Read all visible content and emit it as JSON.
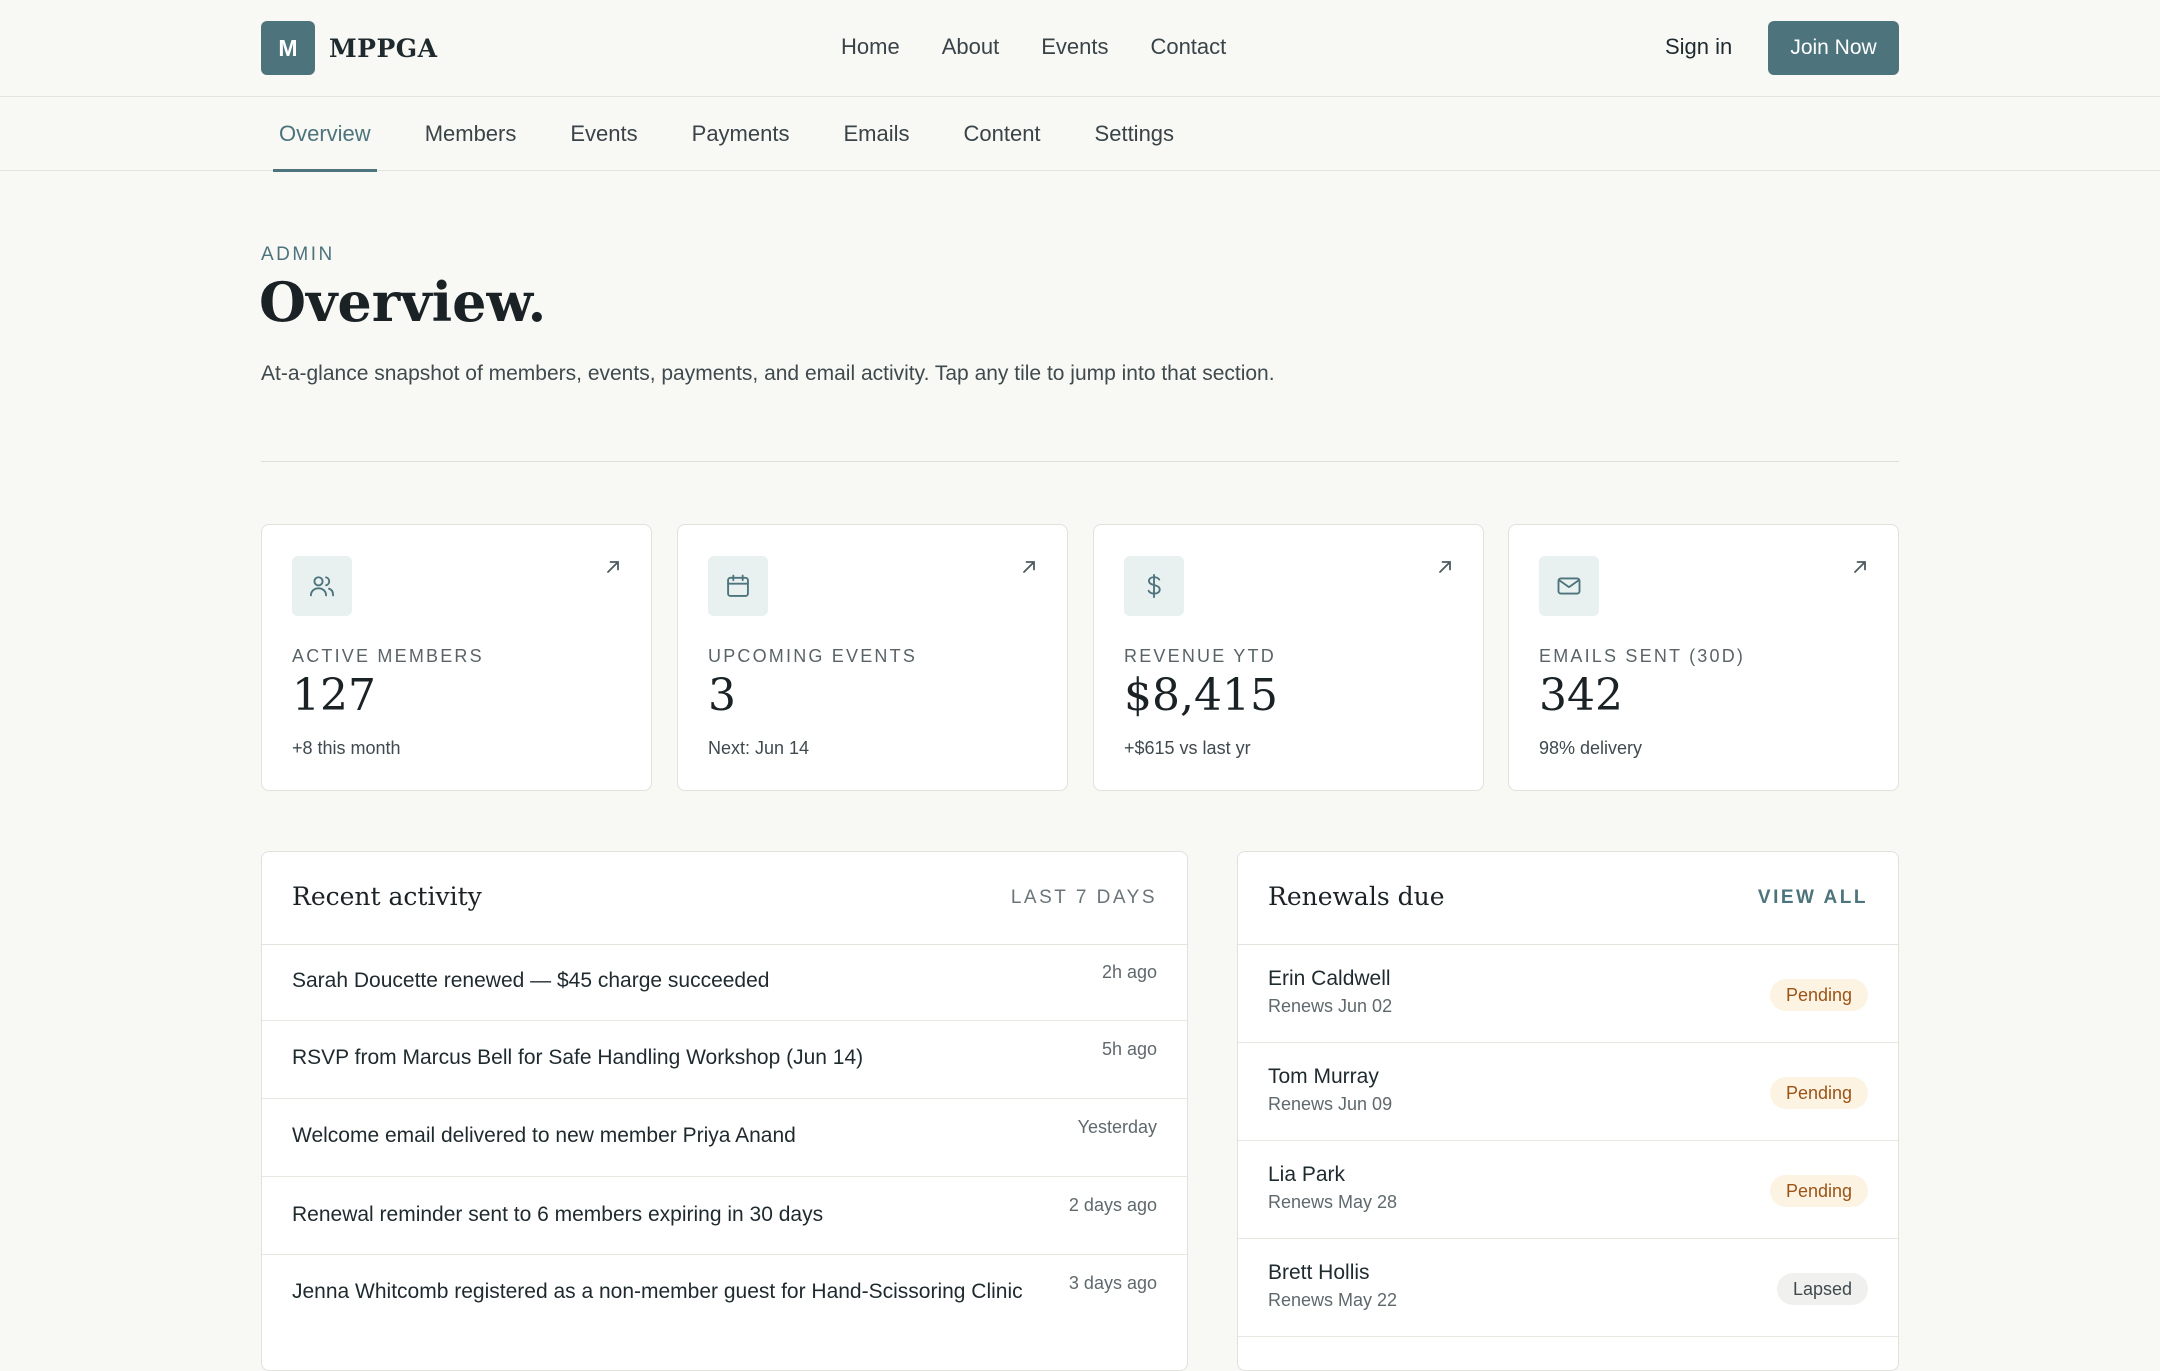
{
  "brand": {
    "mark": "M",
    "name": "MPPGA"
  },
  "main_nav": [
    "Home",
    "About",
    "Events",
    "Contact"
  ],
  "auth": {
    "sign_in": "Sign in",
    "join": "Join Now"
  },
  "admin_tabs": [
    "Overview",
    "Members",
    "Events",
    "Payments",
    "Emails",
    "Content",
    "Settings"
  ],
  "active_tab": "Overview",
  "header": {
    "eyebrow": "ADMIN",
    "title": "Overview.",
    "description": "At-a-glance snapshot of members, events, payments, and email activity. Tap any tile to jump into that section."
  },
  "stats": [
    {
      "icon": "users-icon",
      "label": "ACTIVE MEMBERS",
      "value": "127",
      "note": "+8 this month"
    },
    {
      "icon": "calendar-icon",
      "label": "UPCOMING EVENTS",
      "value": "3",
      "note": "Next: Jun 14"
    },
    {
      "icon": "dollar-icon",
      "label": "REVENUE YTD",
      "value": "$8,415",
      "note": "+$615 vs last yr"
    },
    {
      "icon": "mail-icon",
      "label": "EMAILS SENT (30D)",
      "value": "342",
      "note": "98% delivery"
    }
  ],
  "recent_activity": {
    "title": "Recent activity",
    "range": "LAST 7 DAYS",
    "items": [
      {
        "text": "Sarah Doucette renewed — $45 charge succeeded",
        "time": "2h ago"
      },
      {
        "text": "RSVP from Marcus Bell for Safe Handling Workshop (Jun 14)",
        "time": "5h ago"
      },
      {
        "text": "Welcome email delivered to new member Priya Anand",
        "time": "Yesterday"
      },
      {
        "text": "Renewal reminder sent to 6 members expiring in 30 days",
        "time": "2 days ago"
      },
      {
        "text": "Jenna Whitcomb registered as a non-member guest for Hand-Scissoring Clinic",
        "time": "3 days ago"
      }
    ]
  },
  "renewals": {
    "title": "Renewals due",
    "action": "VIEW ALL",
    "items": [
      {
        "name": "Erin Caldwell",
        "date": "Renews Jun 02",
        "status": "Pending"
      },
      {
        "name": "Tom Murray",
        "date": "Renews Jun 09",
        "status": "Pending"
      },
      {
        "name": "Lia Park",
        "date": "Renews May 28",
        "status": "Pending"
      },
      {
        "name": "Brett Hollis",
        "date": "Renews May 22",
        "status": "Lapsed"
      }
    ]
  },
  "colors": {
    "accent": "#4d747c",
    "background": "#f8f8f5",
    "pending": "#9a5416",
    "pending_bg": "#fdf3e3"
  }
}
